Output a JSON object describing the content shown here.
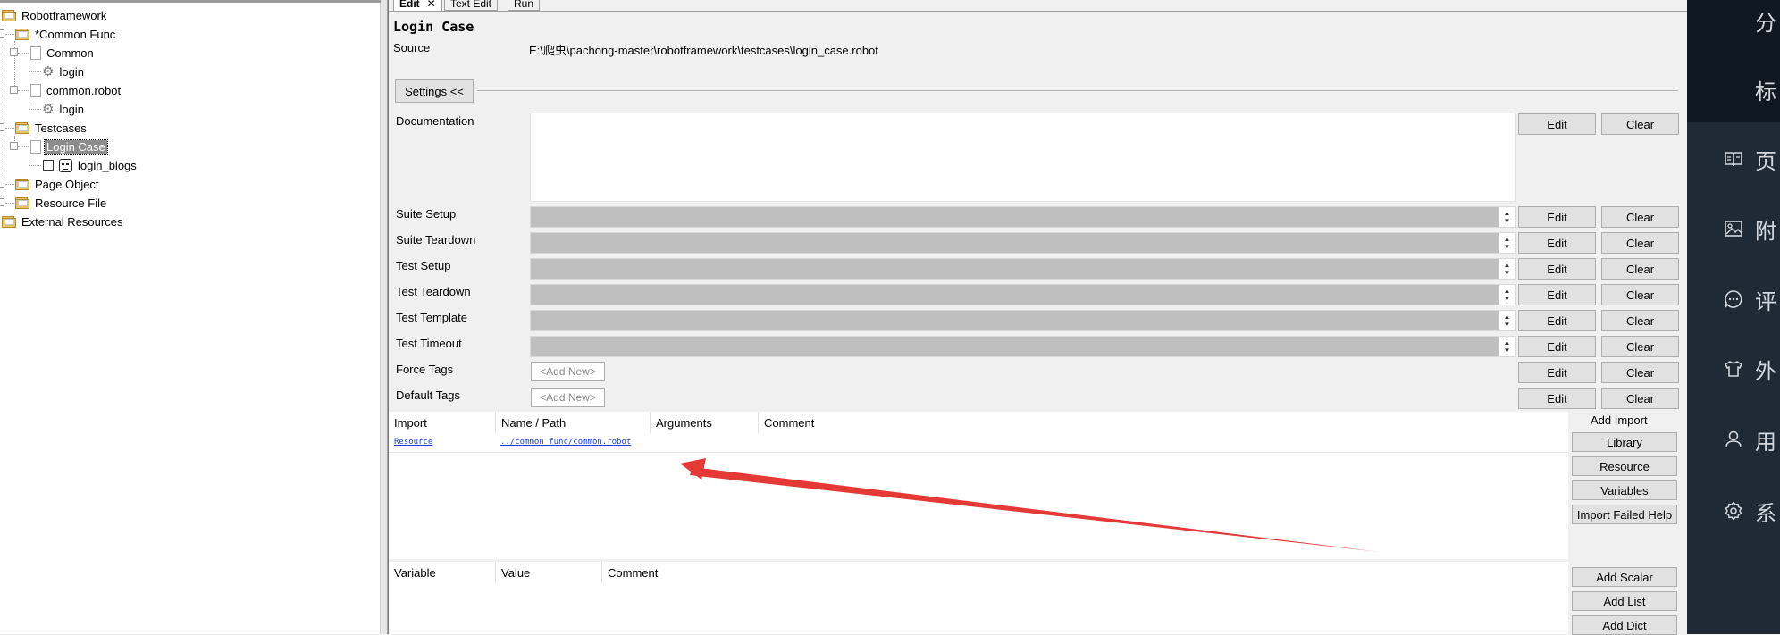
{
  "tree": {
    "items": [
      {
        "label": "Robotframework"
      },
      {
        "label": "*Common Func"
      },
      {
        "label": "Common"
      },
      {
        "label": "login"
      },
      {
        "label": "common.robot"
      },
      {
        "label": "login"
      },
      {
        "label": "Testcases"
      },
      {
        "label": "Login Case"
      },
      {
        "label": "login_blogs"
      },
      {
        "label": "Page Object"
      },
      {
        "label": "Resource File"
      },
      {
        "label": "External Resources"
      }
    ],
    "selected": "Login Case"
  },
  "tabs": [
    {
      "label": "Edit"
    },
    {
      "label": "Text Edit"
    },
    {
      "label": "Run"
    }
  ],
  "editor": {
    "title": "Login Case",
    "source_label": "Source",
    "source_value": "E:\\爬虫\\pachong-master\\robotframework\\testcases\\login_case.robot",
    "settings_button": "Settings <<",
    "documentation_label": "Documentation",
    "edit_label": "Edit",
    "clear_label": "Clear",
    "settings": [
      {
        "label": "Suite Setup"
      },
      {
        "label": "Suite Teardown"
      },
      {
        "label": "Test Setup"
      },
      {
        "label": "Test Teardown"
      },
      {
        "label": "Test Template"
      },
      {
        "label": "Test Timeout"
      }
    ],
    "tags": [
      {
        "label": "Force Tags",
        "placeholder": "<Add New>"
      },
      {
        "label": "Default Tags",
        "placeholder": "<Add New>"
      }
    ]
  },
  "imports": {
    "columns": [
      "Import",
      "Name / Path",
      "Arguments",
      "Comment"
    ],
    "rows": [
      {
        "import": "Resource",
        "path": "../common_func/common.robot"
      }
    ],
    "add_label": "Add Import",
    "buttons": [
      "Library",
      "Resource",
      "Variables",
      "Import Failed Help"
    ]
  },
  "variables": {
    "columns": [
      "Variable",
      "Value",
      "Comment"
    ],
    "buttons": [
      "Add Scalar",
      "Add List",
      "Add Dict"
    ]
  },
  "side_panel": {
    "items": [
      {
        "icon": "none",
        "text": "分"
      },
      {
        "icon": "none",
        "text": "标"
      },
      {
        "icon": "book-icon",
        "text": "页"
      },
      {
        "icon": "image-icon",
        "text": "附"
      },
      {
        "icon": "comment-icon",
        "text": "评"
      },
      {
        "icon": "shirt-icon",
        "text": "外"
      },
      {
        "icon": "user-icon",
        "text": "用"
      },
      {
        "icon": "gear-icon",
        "text": "系"
      }
    ]
  },
  "colors": {
    "arrow": "#e53935",
    "link": "#1a3fd0",
    "dark_panel": "#1e2a36",
    "combo_fill": "#bfbfbf"
  }
}
